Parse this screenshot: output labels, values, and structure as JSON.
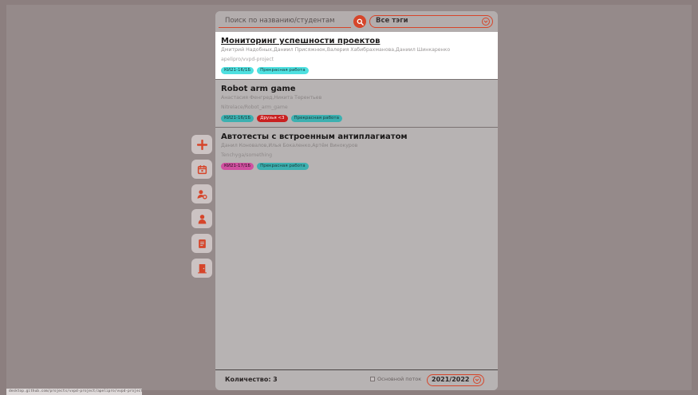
{
  "search": {
    "placeholder": "Поиск по названию/студентам",
    "tags_selected": "Все тэги"
  },
  "projects": [
    {
      "title": "Мониторинг успешности проектов",
      "students": "Дмитрий Надобных,Даниил Присяжнюк,Валерия Хабибрахманова,Даниил Шинкаренко",
      "repo": "apelipro/vvpd-project",
      "tags": [
        "КИ21-16/1Б",
        "Прекрасная работа"
      ]
    },
    {
      "title": "Robot arm game",
      "students": "Анастасия Фенгред,Никита Терентьев",
      "repo": "Nitrelace/Robot_arm_game",
      "tags": [
        "КИ21-16/1Б",
        "Друзья <3",
        "Прекрасная работа"
      ]
    },
    {
      "title": "Автотесты с встроенным антиплагиатом",
      "students": "Данил Коновалов,Илья Бокаленко,Артём Винокуров",
      "repo": "Tenchyga/something",
      "tags": [
        "КИ21-17/1Б",
        "Прекрасная работа"
      ]
    }
  ],
  "footer": {
    "count_label": "Количество:",
    "count_value": "3",
    "stream_label": "Основной поток",
    "year": "2021/2022"
  },
  "status_bar": {
    "url": "desktop.github.com/projects/vvpd-project/apelipro/vvpd-project"
  },
  "sidebar": {
    "icons": [
      "plus-icon",
      "calendar-icon",
      "user-settings-icon",
      "user-icon",
      "document-icon",
      "exit-door-icon"
    ]
  },
  "colors": {
    "accent": "#d6452a",
    "tag_cyan": "#4fe0e0",
    "tag_red": "#c82020",
    "tag_pink": "#d050a0"
  }
}
